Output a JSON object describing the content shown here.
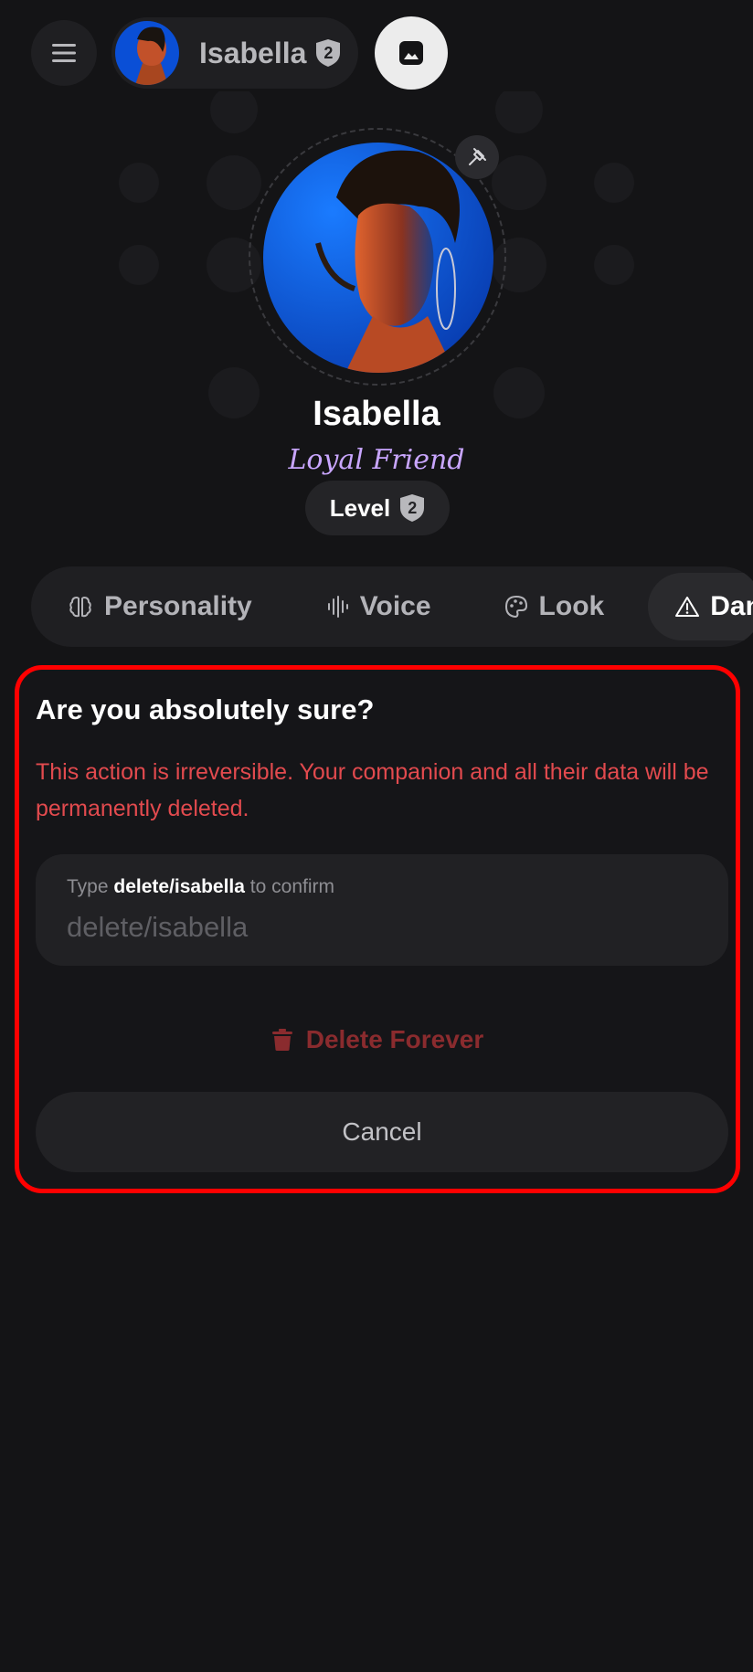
{
  "header": {
    "menu_icon": "hamburger-menu-icon",
    "companion_name": "Isabella",
    "companion_level": "2",
    "image_icon": "image-icon"
  },
  "profile": {
    "name": "Isabella",
    "role": "Loyal Friend",
    "level_label": "Level",
    "level_value": "2",
    "pin_icon": "pin-icon"
  },
  "tabs": [
    {
      "label": "Personality",
      "icon": "brain-icon"
    },
    {
      "label": "Voice",
      "icon": "waveform-icon"
    },
    {
      "label": "Look",
      "icon": "palette-icon"
    },
    {
      "label": "Dang",
      "icon": "warning-icon"
    }
  ],
  "danger": {
    "title": "Are you absolutely sure?",
    "warning": "This action is irreversible. Your companion and all their data will be permanently deleted.",
    "confirm_prefix": "Type",
    "confirm_phrase": "delete/isabella",
    "confirm_suffix": "to confirm",
    "input_value": "",
    "input_placeholder": "delete/isabella",
    "delete_label": "Delete Forever",
    "cancel_label": "Cancel"
  },
  "colors": {
    "background": "#141416",
    "accent_purple": "#c9a6ff",
    "danger_red": "#e24a4e",
    "highlight_border": "#ff0000"
  }
}
